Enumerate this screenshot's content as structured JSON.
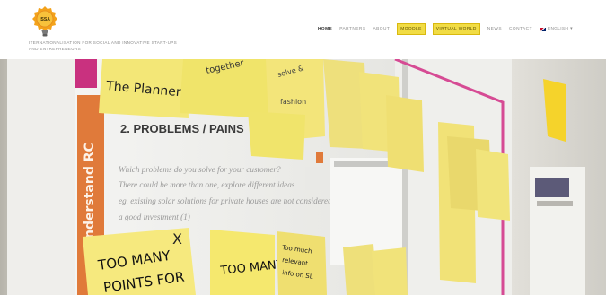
{
  "header": {
    "logo_text": "ISSA",
    "tagline": "ITERNATIONALISATION FOR SOCIAL AND INNOVATIVE START-UPS AND ENTREPRENEURS"
  },
  "nav": {
    "items": [
      {
        "label": "HOME",
        "state": "active"
      },
      {
        "label": "PARTNERS",
        "state": "normal"
      },
      {
        "label": "ABOUT",
        "state": "normal"
      },
      {
        "label": "MOODLE",
        "state": "highlight"
      },
      {
        "label": "VIRTUAL WORLD",
        "state": "highlight"
      },
      {
        "label": "NEWS",
        "state": "normal"
      },
      {
        "label": "CONTACT",
        "state": "normal"
      }
    ],
    "language": {
      "label": "ENGLISH",
      "caret": "▾"
    }
  },
  "hero": {
    "board_heading": "2. PROBLEMS / PAINS",
    "side_label": "nderstand RC",
    "body_lines": [
      "Which problems do you solve for your customer?",
      "There could be more than one, explore different ideas",
      "eg. existing solar solutions for private houses are not considered",
      "a good investment (1)"
    ],
    "notes": {
      "planner": "The Planner",
      "top_center": "together",
      "small_a": "solve &",
      "small_b": "fashion",
      "too_many_1": "TOO MANY",
      "points_for": "POINTS FOR",
      "too_many_2": "TOO MANY",
      "far_right": "Too much",
      "far_right_2": "relevant",
      "far_right_3": "info on SL"
    },
    "cross_mark": "X"
  }
}
